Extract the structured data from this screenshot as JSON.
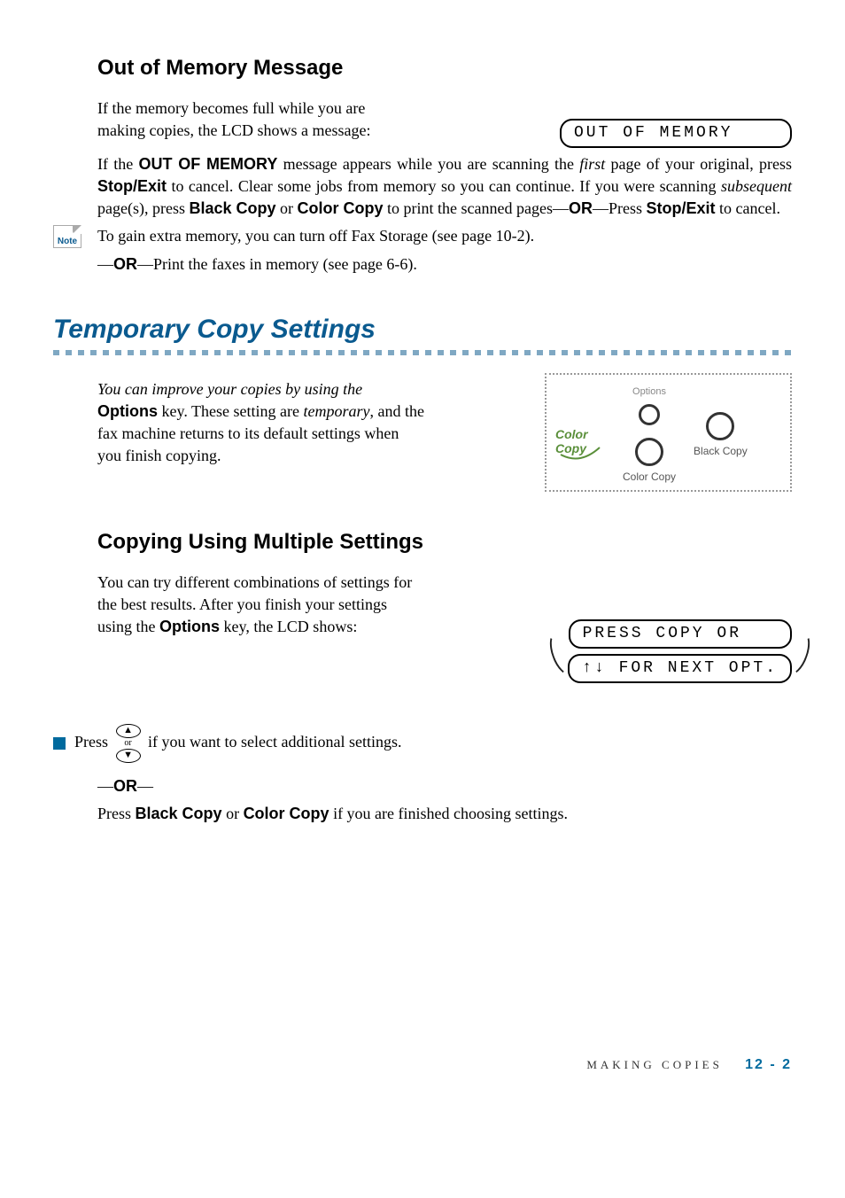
{
  "section1": {
    "heading": "Out of Memory Message",
    "intro": "If the memory becomes full while you are making copies, the LCD shows a message:",
    "lcd": "OUT OF MEMORY",
    "p2_a": "If the ",
    "p2_bold1": "OUT OF MEMORY",
    "p2_b": " message appears while you are scanning the ",
    "p2_it1": "first",
    "p2_c": " page of your original, press ",
    "p2_bold2": "Stop/Exit",
    "p2_d": " to cancel. Clear some jobs from memory so you can continue. If you were scanning ",
    "p2_it2": "subsequent",
    "p2_e": " page(s), press ",
    "p2_bold3": "Black Copy",
    "p2_f": " or ",
    "p2_bold4": "Color Copy",
    "p2_g": " to print the scanned pages—",
    "p2_bold5": "OR",
    "p2_h": "—Press ",
    "p2_bold6": "Stop/Exit",
    "p2_i": " to cancel.",
    "note_label": "Note",
    "note_a": "To gain extra memory, you can turn off Fax Storage (see page 10-2).",
    "note_b": "—",
    "note_bold": "OR",
    "note_c": "—Print the faxes in memory (see page 6-6)."
  },
  "section2": {
    "title": "Temporary Copy Settings",
    "intro_a": "You can improve your copies by using the ",
    "intro_bold": "Options",
    "intro_b": " key. These setting are ",
    "intro_it": "temporary",
    "intro_c": ", and the fax machine returns to its default settings when you finish copying.",
    "panel": {
      "colorcopy": "Color\nCopy",
      "options": "Options",
      "colorcopy_btn": "Color Copy",
      "blackcopy_btn": "Black Copy"
    }
  },
  "section3": {
    "heading": "Copying Using Multiple Settings",
    "intro_a": "You can try different combinations of settings for the best results. After you finish your settings using the ",
    "intro_bold": "Options",
    "intro_b": " key, the LCD shows:",
    "lcd1": "PRESS COPY OR",
    "lcd2": "↑↓ FOR NEXT OPT.",
    "press": "Press ",
    "or_small": "or",
    "press_b": " if you want to select additional settings.",
    "or": "—OR—",
    "final_a": "Press ",
    "final_b1": "Black Copy",
    "final_c": " or ",
    "final_b2": "Color Copy",
    "final_d": " if you are finished choosing settings."
  },
  "footer": {
    "chapter": "MAKING COPIES",
    "page": "12 - 2"
  }
}
